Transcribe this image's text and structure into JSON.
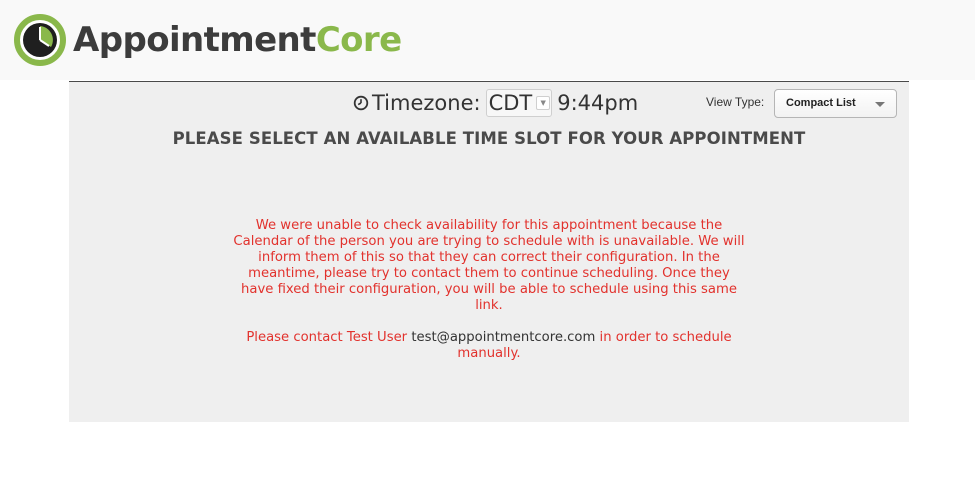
{
  "brand": {
    "name_part1": "Appointment",
    "name_part2": "Core",
    "accent_color": "#8ab84b",
    "dark_color": "#3c3c3c"
  },
  "timezone": {
    "icon": "clock-icon",
    "label": "Timezone:",
    "selected": "CDT",
    "current_time": "9:44pm"
  },
  "view_type": {
    "label": "View Type:",
    "selected": "Compact List",
    "icon": "caret-down-icon"
  },
  "heading": "PLEASE SELECT AN AVAILABLE TIME SLOT FOR YOUR APPOINTMENT",
  "error_message": "We were unable to check availability for this appointment because the Calendar of the person you are trying to schedule with is unavailable. We will inform them of this so that they can correct their configuration. In the meantime, please try to contact them to continue scheduling. Once they have fixed their configuration, you will be able to schedule using this same link.",
  "contact": {
    "prefix": "Please contact Test User",
    "email": "test@appointmentcore.com",
    "suffix": "in order to schedule manually."
  },
  "colors": {
    "error_text": "#e2322d",
    "panel_bg": "#efefef",
    "header_bg": "#f9f9f9"
  }
}
